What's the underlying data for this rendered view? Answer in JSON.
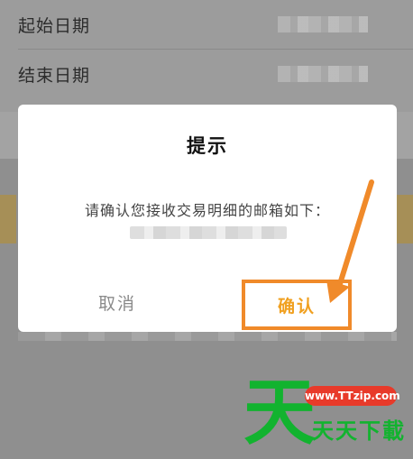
{
  "background_form": {
    "start_date_label": "起始日期",
    "end_date_label": "结束日期"
  },
  "dialog": {
    "title": "提示",
    "message": "请确认您接收交易明细的邮箱如下：",
    "cancel_label": "取消",
    "confirm_label": "确认"
  },
  "watermark": {
    "logo_char": "天",
    "url": "www.TTzip.com",
    "text": "天天下載"
  },
  "colors": {
    "confirm_accent": "#f0a020",
    "annotation_orange": "#f08a2a",
    "watermark_green": "#12b32f",
    "watermark_red": "#e83a2a"
  }
}
